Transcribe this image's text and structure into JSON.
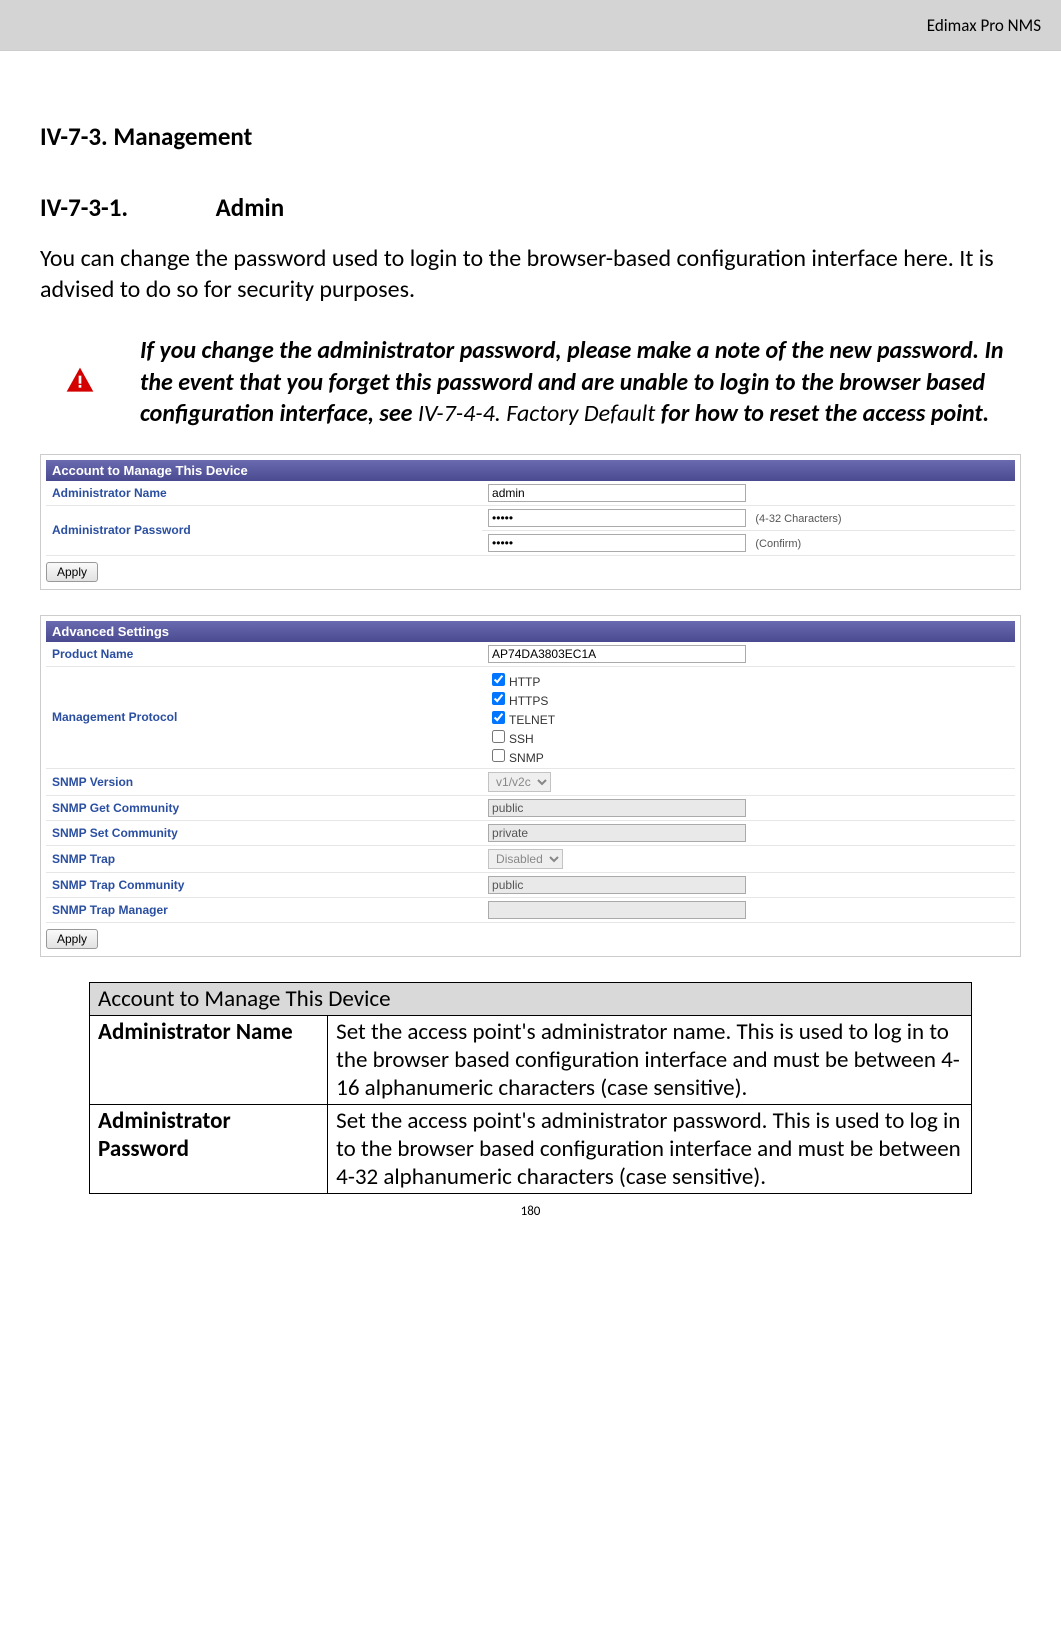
{
  "header": {
    "product": "Edimax Pro NMS"
  },
  "headings": {
    "h1": "IV-7-3. Management",
    "h2_num": "IV-7-3-1.",
    "h2_title": "Admin"
  },
  "intro": "You can change the password used to login to the browser-based configuration interface here. It is advised to do so for security purposes.",
  "note": {
    "part1": "If you change the administrator password, please make a note of the new password. In the event that you forget this password and are unable to login to the browser based configuration interface, see ",
    "ref": "IV-7-4-4. Factory Default",
    "part2": " for how to reset the access point."
  },
  "panel1": {
    "title": "Account to Manage This Device",
    "rows": {
      "admin_name": {
        "label": "Administrator Name",
        "value": "admin"
      },
      "admin_pw": {
        "label": "Administrator Password",
        "value": "•••••",
        "hint1": "(4-32 Characters)",
        "value2": "•••••",
        "hint2": "(Confirm)"
      }
    },
    "apply": "Apply"
  },
  "panel2": {
    "title": "Advanced Settings",
    "rows": {
      "product_name": {
        "label": "Product Name",
        "value": "AP74DA3803EC1A"
      },
      "mgmt_proto": {
        "label": "Management Protocol",
        "opts": [
          {
            "label": "HTTP",
            "checked": true
          },
          {
            "label": "HTTPS",
            "checked": true
          },
          {
            "label": "TELNET",
            "checked": true
          },
          {
            "label": "SSH",
            "checked": false
          },
          {
            "label": "SNMP",
            "checked": false
          }
        ]
      },
      "snmp_ver": {
        "label": "SNMP Version",
        "value": "v1/v2c"
      },
      "snmp_get": {
        "label": "SNMP Get Community",
        "value": "public"
      },
      "snmp_set": {
        "label": "SNMP Set Community",
        "value": "private"
      },
      "snmp_trap": {
        "label": "SNMP Trap",
        "value": "Disabled"
      },
      "snmp_trap_c": {
        "label": "SNMP Trap Community",
        "value": "public"
      },
      "snmp_trap_m": {
        "label": "SNMP Trap Manager",
        "value": ""
      }
    },
    "apply": "Apply"
  },
  "desc_table": {
    "section": "Account to Manage This Device",
    "rows": [
      {
        "term": "Administrator Name",
        "text": "Set the access point's administrator name. This is used to log in to the browser based configuration interface and must be between 4-16 alphanumeric characters (case sensitive)."
      },
      {
        "term": "Administrator Password",
        "text": "Set the access point's administrator password. This is used to log in to the browser based configuration interface and must be between 4-32 alphanumeric characters (case sensitive)."
      }
    ]
  },
  "page_number": "180"
}
